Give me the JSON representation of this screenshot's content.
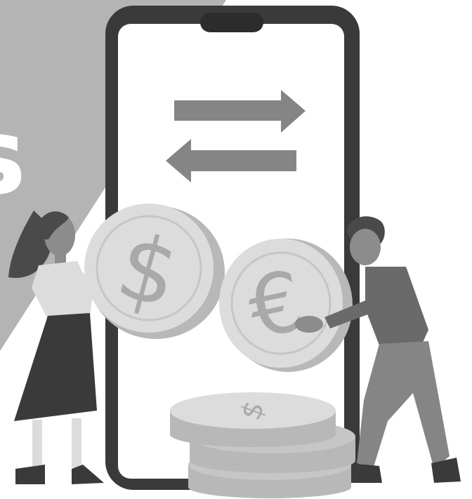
{
  "illustration": {
    "partial_heading_letter": "s",
    "coin_symbols": {
      "dollar": "$",
      "euro": "€"
    },
    "palette": {
      "background": "#ffffff",
      "banner": "#b4b4b4",
      "phone_frame": "#3a3a3a",
      "screen": "#ffffff",
      "arrows": "#858585",
      "coin_face": "#dcdcdc",
      "coin_edge": "#b8b8b8",
      "coin_symbol": "#a9a9a9",
      "person_dark": "#4a4a4a",
      "person_mid": "#858585",
      "skin": "#8c8c8c"
    },
    "icons": [
      "smartphone-icon",
      "transfer-arrows-icon",
      "dollar-coin-icon",
      "euro-coin-icon",
      "coin-stack-icon"
    ]
  }
}
